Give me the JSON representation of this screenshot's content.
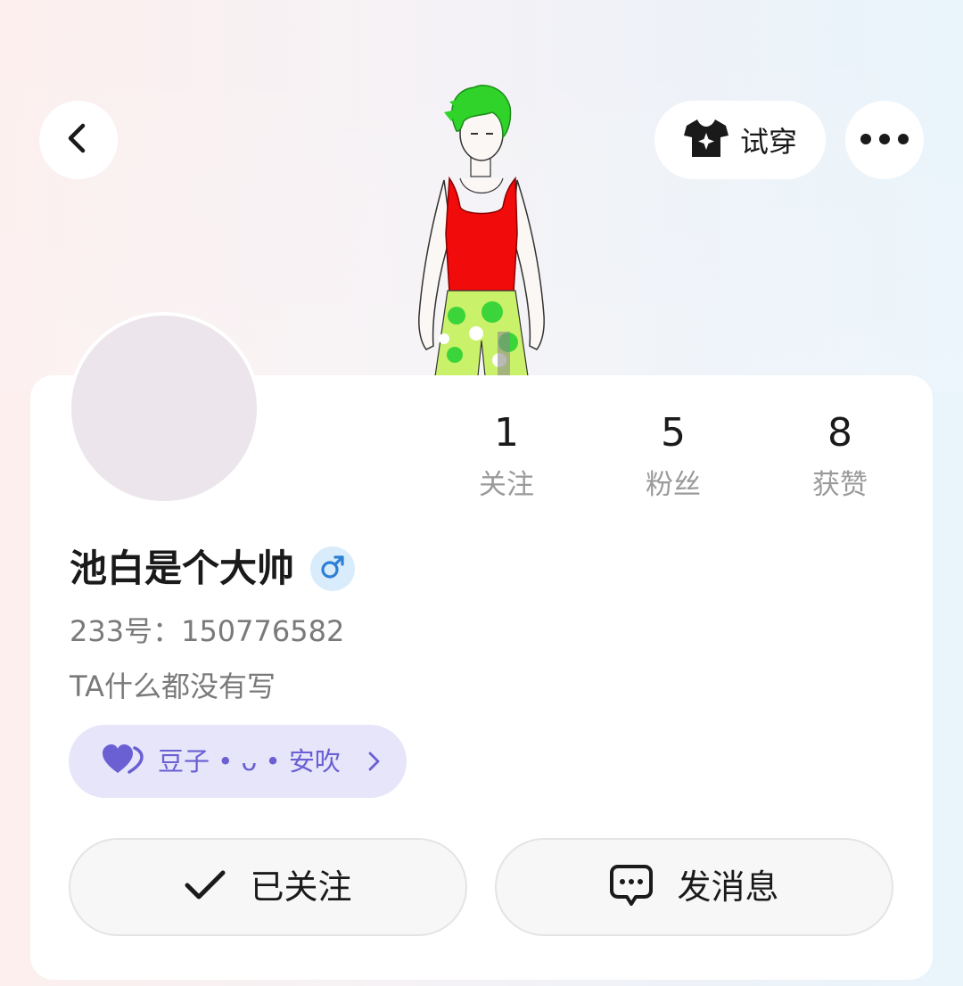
{
  "header": {
    "back_icon": "chevron-left-icon",
    "try_on_label": "试穿",
    "try_on_icon": "tshirt-sparkle-icon",
    "more_icon": "more-horizontal-icon"
  },
  "stats": [
    {
      "value": "1",
      "label": "关注"
    },
    {
      "value": "5",
      "label": "粉丝"
    },
    {
      "value": "8",
      "label": "获赞"
    }
  ],
  "profile": {
    "username": "池白是个大帅",
    "gender_icon": "male-icon",
    "user_id": "233号：150776582",
    "bio": "TA什么都没有写"
  },
  "cp_chip": {
    "label": "豆子 • ᴗ • 安吹",
    "icon": "double-heart-icon"
  },
  "actions": {
    "follow_label": "已关注",
    "message_label": "发消息"
  },
  "colors": {
    "accent_purple": "#6a5fd3",
    "chip_bg": "#e6e5fa",
    "gender_blue": "#2e7fd6"
  }
}
